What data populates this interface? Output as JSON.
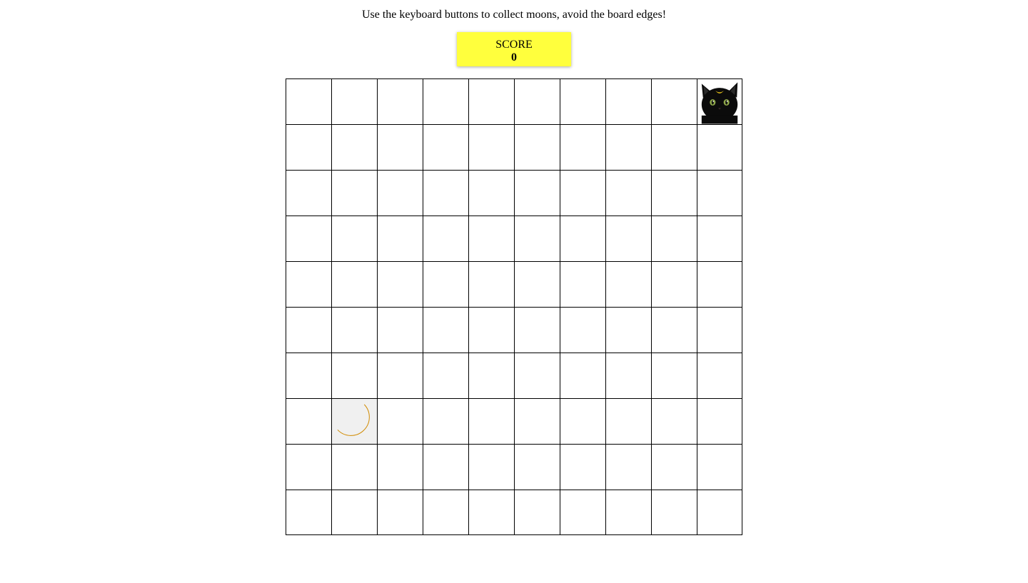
{
  "instructions": "Use the keyboard buttons to collect moons, avoid the board edges!",
  "score": {
    "label": "SCORE",
    "value": "0"
  },
  "board": {
    "rows": 10,
    "cols": 10,
    "player": {
      "row": 0,
      "col": 9,
      "icon": "black-cat-icon"
    },
    "moon": {
      "row": 7,
      "col": 1,
      "icon": "crescent-moon-icon"
    }
  }
}
